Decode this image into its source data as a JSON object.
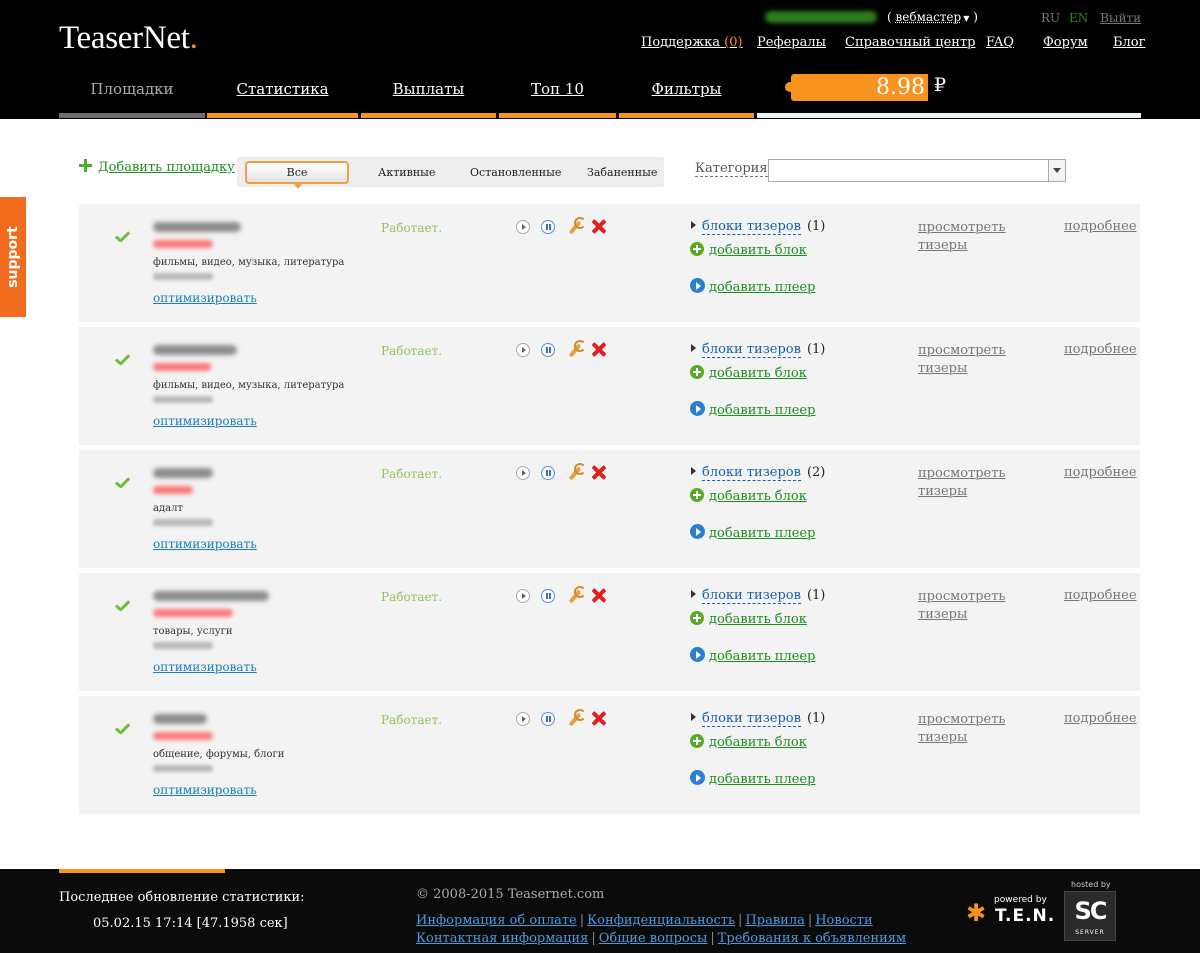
{
  "header": {
    "logo": "TeaserNet",
    "logo_dot": ".",
    "role": "вебмастер",
    "lang_ru": "RU",
    "lang_en": "EN",
    "logout": "Выйти",
    "links": {
      "support": "Поддержка",
      "support_count": "(0)",
      "referrals": "Рефералы",
      "help": "Справочный центр",
      "faq": "FAQ",
      "forum": "Форум",
      "blog": "Блог"
    },
    "tabs": [
      "Площадки",
      "Статистика",
      "Выплаты",
      "Топ 10",
      "Фильтры"
    ],
    "balance": "8.98",
    "currency": "₽"
  },
  "support_tab": "support",
  "toolbar": {
    "add_site": "Добавить площадку",
    "filters": [
      "Все",
      "Активные",
      "Остановленные",
      "Забаненные"
    ],
    "category_label": "Категория",
    "category_value": ""
  },
  "sites": [
    {
      "category": "фильмы, видео, музыка, литература",
      "optimize": "оптимизировать",
      "status": "Работает.",
      "blocks_label": "блоки тизеров",
      "blocks_count": "(1)",
      "add_block": "добавить блок",
      "add_player": "добавить плеер",
      "view1": "просмотреть",
      "view2": "тизеры",
      "details": "подробнее"
    },
    {
      "category": "фильмы, видео, музыка, литература",
      "optimize": "оптимизировать",
      "status": "Работает.",
      "blocks_label": "блоки тизеров",
      "blocks_count": "(1)",
      "add_block": "добавить блок",
      "add_player": "добавить плеер",
      "view1": "просмотреть",
      "view2": "тизеры",
      "details": "подробнее"
    },
    {
      "category": "адалт",
      "optimize": "оптимизировать",
      "status": "Работает.",
      "blocks_label": "блоки тизеров",
      "blocks_count": "(2)",
      "add_block": "добавить блок",
      "add_player": "добавить плеер",
      "view1": "просмотреть",
      "view2": "тизеры",
      "details": "подробнее"
    },
    {
      "category": "товары, услуги",
      "optimize": "оптимизировать",
      "status": "Работает.",
      "blocks_label": "блоки тизеров",
      "blocks_count": "(1)",
      "add_block": "добавить блок",
      "add_player": "добавить плеер",
      "view1": "просмотреть",
      "view2": "тизеры",
      "details": "подробнее"
    },
    {
      "category": "общение, форумы, блоги",
      "optimize": "оптимизировать",
      "status": "Работает.",
      "blocks_label": "блоки тизеров",
      "blocks_count": "(1)",
      "add_block": "добавить блок",
      "add_player": "добавить плеер",
      "view1": "просмотреть",
      "view2": "тизеры",
      "details": "подробнее"
    }
  ],
  "footer": {
    "update_label": "Последнее обновление статистики:",
    "update_value": "05.02.15 17:14 [47.1958 сек]",
    "copyright": "© 2008-2015 Teasernet.com",
    "links_row1": [
      "Информация об оплате",
      "Конфиденциальность",
      "Правила",
      "Новости"
    ],
    "links_row2": [
      "Контактная информация",
      "Общие вопросы",
      "Требования к объявлениям"
    ],
    "powered_by": "powered by",
    "ten": "T.E.N.",
    "hosted_by": "hosted by",
    "server_logo": "SC",
    "server_text": "SERVER"
  }
}
